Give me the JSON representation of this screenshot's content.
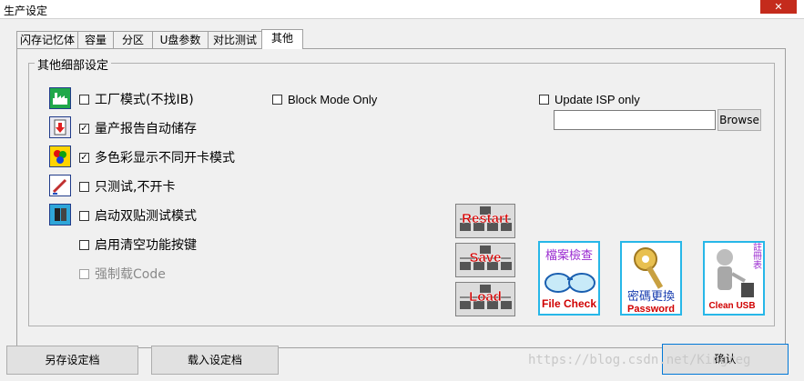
{
  "window": {
    "title": "生产设定",
    "close_glyph": "✕"
  },
  "tabs": [
    {
      "label": "闪存记忆体",
      "active": false
    },
    {
      "label": "容量",
      "active": false
    },
    {
      "label": "分区",
      "active": false
    },
    {
      "label": "U盘参数",
      "active": false
    },
    {
      "label": "对比测试",
      "active": false
    },
    {
      "label": "其他",
      "active": true
    }
  ],
  "group": {
    "title": "其他细部设定"
  },
  "options": [
    {
      "label": "工厂模式(不找IB)",
      "checked": false,
      "enabled": true,
      "icon": "factory-icon"
    },
    {
      "label": "量产报告自动储存",
      "checked": true,
      "enabled": true,
      "icon": "report-save-icon"
    },
    {
      "label": "多色彩显示不同开卡模式",
      "checked": true,
      "enabled": true,
      "icon": "color-dots-icon"
    },
    {
      "label": "只测试,不开卡",
      "checked": false,
      "enabled": true,
      "icon": "test-pen-icon"
    },
    {
      "label": "启动双贴测试模式",
      "checked": false,
      "enabled": true,
      "icon": "dual-chip-icon"
    },
    {
      "label": "启用清空功能按键",
      "checked": false,
      "enabled": true
    },
    {
      "label": "强制载Code",
      "checked": false,
      "enabled": false
    }
  ],
  "block_mode": {
    "label": "Block Mode Only",
    "checked": false
  },
  "update_isp": {
    "label": "Update ISP only",
    "checked": false,
    "path_value": "",
    "browse_label": "Browse"
  },
  "action_buttons": [
    {
      "label": "Restart"
    },
    {
      "label": "Save"
    },
    {
      "label": "Load"
    }
  ],
  "tool_buttons": [
    {
      "top_text": "檔案檢查",
      "bottom_text": "File Check",
      "icon": "glasses-icon"
    },
    {
      "top_text": "",
      "middle_text": "密碼更換",
      "bottom_text": "Password",
      "icon": "key-icon"
    },
    {
      "side_text": "註冊表",
      "bottom_text": "Clean USB",
      "icon": "trash-person-icon"
    }
  ],
  "footer": {
    "save_as_label": "另存设定档",
    "load_label": "载入设定档",
    "ok_label": "确认",
    "watermark": "https://blog.csdn.net/Kingreg"
  },
  "colors": {
    "accent_blue": "#27b7e8",
    "red_text": "#d00000",
    "purple_text": "#9a2ad0"
  }
}
